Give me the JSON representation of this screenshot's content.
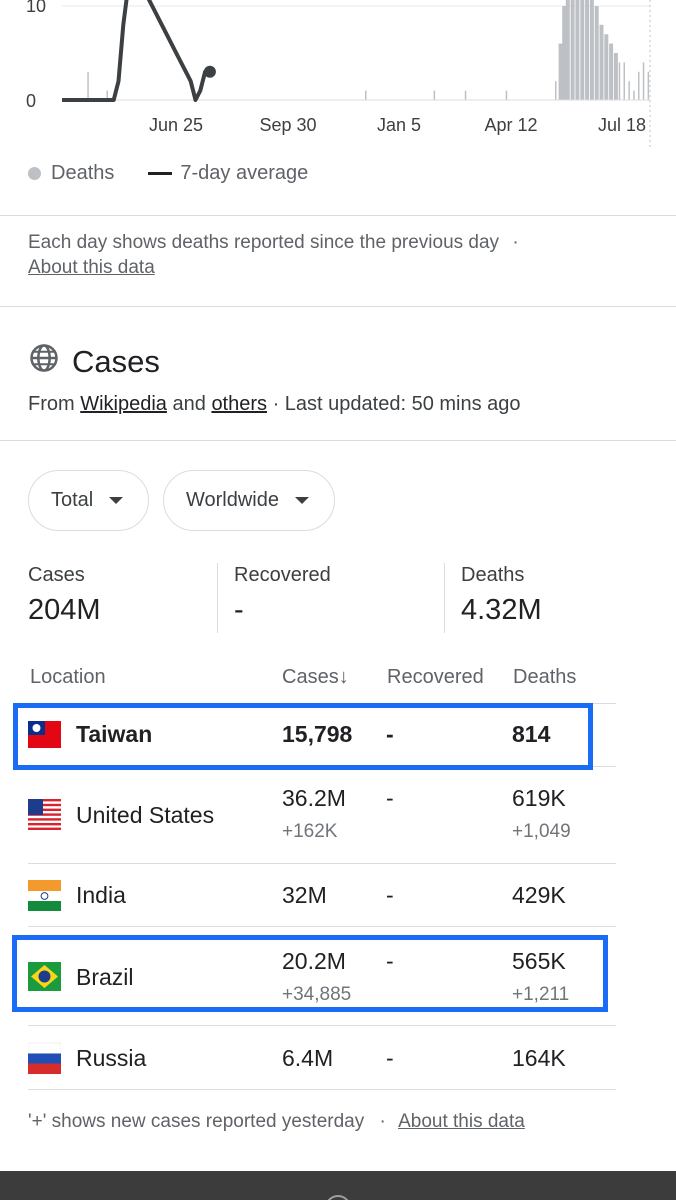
{
  "chart": {
    "y_ticks": [
      "10",
      "0"
    ],
    "x_ticks": [
      "Jun 25",
      "Sep 30",
      "Jan 5",
      "Apr 12",
      "Jul 18"
    ],
    "colors": {
      "bars": "#bdc1c6",
      "average": "#3c4043"
    }
  },
  "chart_data": {
    "type": "bar",
    "series": [
      {
        "name": "Deaths",
        "points": [
          {
            "x": "Apr 22",
            "y": 3
          },
          {
            "x": "May 8",
            "y": 1
          },
          {
            "x": "Dec 9",
            "y": 1
          },
          {
            "x": "Feb 4",
            "y": 1
          },
          {
            "x": "Mar 2",
            "y": 1
          },
          {
            "x": "Apr 5",
            "y": 1
          },
          {
            "x": "May 16",
            "y": 2
          },
          {
            "x": "May 19",
            "y": 6
          },
          {
            "x": "May 22",
            "y": 10
          },
          {
            "x": "May 25",
            "y": 13
          },
          {
            "x": "May 29",
            "y": 14
          },
          {
            "x": "Jun 2",
            "y": 13
          },
          {
            "x": "Jun 6",
            "y": 12
          },
          {
            "x": "Jun 10",
            "y": 12
          },
          {
            "x": "Jun 14",
            "y": 11
          },
          {
            "x": "Jun 18",
            "y": 10
          },
          {
            "x": "Jun 22",
            "y": 8
          },
          {
            "x": "Jun 26",
            "y": 7
          },
          {
            "x": "Jun 30",
            "y": 6
          },
          {
            "x": "Jul 4",
            "y": 5
          },
          {
            "x": "Jul 8",
            "y": 4
          },
          {
            "x": "Jul 12",
            "y": 4
          },
          {
            "x": "Jul 16",
            "y": 2
          },
          {
            "x": "Jul 20",
            "y": 1
          },
          {
            "x": "Jul 24",
            "y": 3
          },
          {
            "x": "Jul 28",
            "y": 4
          },
          {
            "x": "Aug 1",
            "y": 3
          }
        ]
      },
      {
        "name": "7-day average",
        "type": "line",
        "points": [
          {
            "x": "Apr 1",
            "y": 0
          },
          {
            "x": "May 14",
            "y": 0
          },
          {
            "x": "May 18",
            "y": 2
          },
          {
            "x": "May 22",
            "y": 8
          },
          {
            "x": "May 26",
            "y": 12
          },
          {
            "x": "May 30",
            "y": 13
          },
          {
            "x": "Jun 3",
            "y": 12
          },
          {
            "x": "Jun 7",
            "y": 11
          },
          {
            "x": "Jun 11",
            "y": 11
          },
          {
            "x": "Jun 15",
            "y": 10
          },
          {
            "x": "Jun 19",
            "y": 9
          },
          {
            "x": "Jun 23",
            "y": 8
          },
          {
            "x": "Jun 27",
            "y": 7
          },
          {
            "x": "Jul 1",
            "y": 6
          },
          {
            "x": "Jul 5",
            "y": 5
          },
          {
            "x": "Jul 9",
            "y": 4
          },
          {
            "x": "Jul 13",
            "y": 3
          },
          {
            "x": "Jul 17",
            "y": 2
          },
          {
            "x": "Jul 21",
            "y": 0
          },
          {
            "x": "Jul 25",
            "y": 1
          },
          {
            "x": "Jul 29",
            "y": 3
          },
          {
            "x": "Aug 2",
            "y": 3
          }
        ]
      }
    ],
    "x_ticks": [
      "Jun 25",
      "Sep 30",
      "Jan 5",
      "Apr 12",
      "Jul 18"
    ],
    "ylim": [
      0,
      10
    ],
    "legend": "bottom"
  },
  "legend": {
    "bars": "Deaths",
    "line": "7-day average"
  },
  "note": {
    "text": "Each day shows deaths reported since the previous day",
    "sep": "·",
    "link": "About this data"
  },
  "cases": {
    "title": "Cases",
    "source_prefix": "From",
    "source_link_1": "Wikipedia",
    "source_and": "and",
    "source_link_2": "others",
    "updated": "· Last updated: 50 mins ago"
  },
  "filters": {
    "total": "Total",
    "region": "Worldwide"
  },
  "summary": {
    "cases_label": "Cases",
    "cases_value": "204M",
    "recovered_label": "Recovered",
    "recovered_value": "-",
    "deaths_label": "Deaths",
    "deaths_value": "4.32M"
  },
  "table": {
    "headers": {
      "location": "Location",
      "cases": "Cases↓",
      "recovered": "Recovered",
      "deaths": "Deaths"
    },
    "rows": [
      {
        "name": "Taiwan",
        "cases": "15,798",
        "cases_new": "",
        "recovered": "-",
        "deaths": "814",
        "deaths_new": ""
      },
      {
        "name": "United States",
        "cases": "36.2M",
        "cases_new": "+162K",
        "recovered": "-",
        "deaths": "619K",
        "deaths_new": "+1,049"
      },
      {
        "name": "India",
        "cases": "32M",
        "cases_new": "",
        "recovered": "-",
        "deaths": "429K",
        "deaths_new": ""
      },
      {
        "name": "Brazil",
        "cases": "20.2M",
        "cases_new": "+34,885",
        "recovered": "-",
        "deaths": "565K",
        "deaths_new": "+1,211"
      },
      {
        "name": "Russia",
        "cases": "6.4M",
        "cases_new": "",
        "recovered": "-",
        "deaths": "164K",
        "deaths_new": ""
      }
    ]
  },
  "footnote": {
    "text": "'+' shows new cases reported yesterday",
    "sep": "·",
    "link": "About this data"
  },
  "highlight_color": "#1a6bf5"
}
